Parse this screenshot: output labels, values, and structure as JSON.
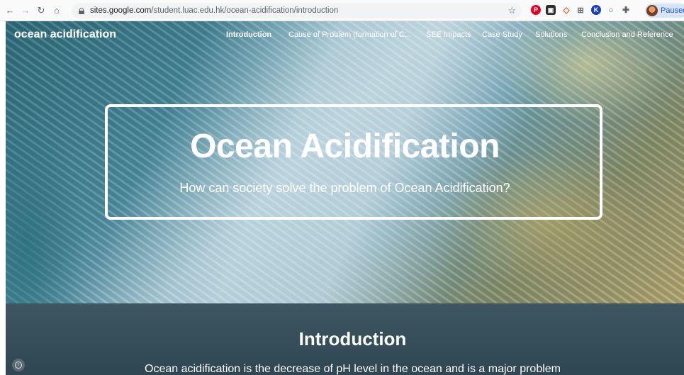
{
  "browser": {
    "url_host": "sites.google.com",
    "url_path": "/student.luac.edu.hk/ocean-acidification/introduction",
    "profile_label": "Paused",
    "icons": [
      "back-arrow-icon",
      "forward-arrow-icon",
      "reload-icon",
      "home-icon",
      "lock-icon",
      "star-icon",
      "pinterest-icon",
      "extension-icon",
      "extension-icon",
      "grid-icon",
      "extension-icon",
      "extension-icon",
      "puzzle-icon"
    ]
  },
  "site": {
    "title": "ocean acidification",
    "nav": [
      "Introduction",
      "Cause of Problem (formation of C...",
      "SEE Impacts",
      "Case Study",
      "Solutions",
      "Conclusion and Reference"
    ]
  },
  "hero": {
    "title": "Ocean Acidification",
    "subtitle": "How can society solve the problem of Ocean Acidification?"
  },
  "intro": {
    "heading": "Introduction",
    "text": "Ocean acidification is the decrease of pH level in the ocean and is a major problem"
  }
}
